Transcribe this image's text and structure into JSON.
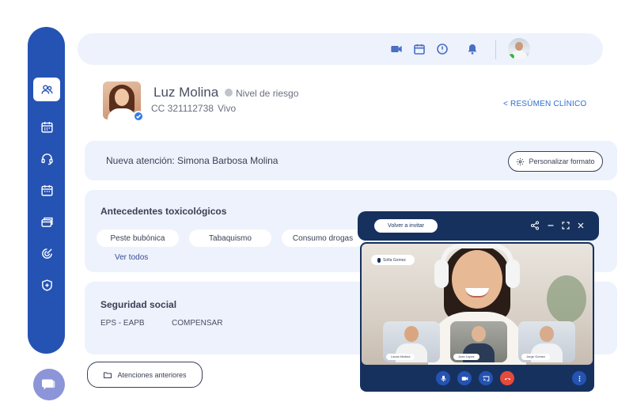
{
  "sidebar": {
    "items": [
      {
        "icon": "users-icon",
        "active": true
      },
      {
        "icon": "calendar-icon",
        "active": false
      },
      {
        "icon": "headset-icon",
        "active": false
      },
      {
        "icon": "calendar-icon",
        "active": false
      },
      {
        "icon": "cards-icon",
        "active": false
      },
      {
        "icon": "target-icon",
        "active": false
      },
      {
        "icon": "shield-plus-icon",
        "active": false
      }
    ],
    "chat_icon": "chat-icon"
  },
  "topbar": {
    "icons": [
      "video-icon",
      "calendar-icon",
      "alert-icon",
      "bell-icon"
    ]
  },
  "patient": {
    "name": "Luz Molina",
    "risk_label": "Nivel de riesgo",
    "id": "CC 321112738",
    "status": "Vivo",
    "resumen_link": "< RESÚMEN CLÍNICO"
  },
  "attention": {
    "title": "Nueva atención: Simona Barbosa Molina",
    "customize_label": "Personalizar formato"
  },
  "toxicology": {
    "title": "Antecedentes toxicológicos",
    "pills": [
      "Peste bubónica",
      "Tabaquismo",
      "Consumo drogas"
    ],
    "see_all": "Ver todos"
  },
  "social_security": {
    "title": "Seguridad social",
    "items": [
      "EPS - EAPB",
      "COMPENSAR"
    ]
  },
  "previous_button": "Atenciones anteriores",
  "video_call": {
    "reinvite_label": "Volver a invitar",
    "main_participant_tag": "Sofia Gomez",
    "thumbs": [
      "Laura Medina",
      "Juan Lopez",
      "Jorge Gomez"
    ]
  },
  "colors": {
    "primary": "#2553b3",
    "card_bg": "#edf2fc",
    "video_dark": "#16315e",
    "hangup": "#e64a3b",
    "online": "#37b44a"
  }
}
